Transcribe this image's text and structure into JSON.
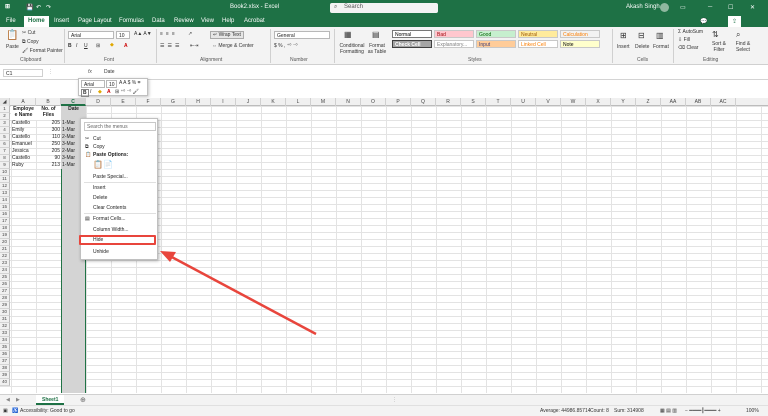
{
  "titlebar": {
    "filename": "Book2.xlsx - Excel",
    "search": "Search",
    "user": "Akash Singh"
  },
  "tabs": [
    "File",
    "Home",
    "Insert",
    "Page Layout",
    "Formulas",
    "Data",
    "Review",
    "View",
    "Help",
    "Acrobat"
  ],
  "ribbon": {
    "clipboard": {
      "paste": "Paste",
      "cut": "Cut",
      "copy": "Copy",
      "format_painter": "Format Painter",
      "label": "Clipboard"
    },
    "font": {
      "name": "Arial",
      "size": "10",
      "label": "Font"
    },
    "alignment": {
      "wrap": "Wrap Text",
      "merge": "Merge & Center",
      "label": "Alignment"
    },
    "number": {
      "format": "General",
      "label": "Number"
    },
    "styles": {
      "conditional": "Conditional Formatting",
      "format_table": "Format as Table",
      "items": [
        {
          "label": "Normal",
          "bg": "#ffffff",
          "fg": "#000000"
        },
        {
          "label": "Bad",
          "bg": "#ffc7ce",
          "fg": "#9c0006"
        },
        {
          "label": "Good",
          "bg": "#c6efce",
          "fg": "#006100"
        },
        {
          "label": "Neutral",
          "bg": "#ffeb9c",
          "fg": "#9c5700"
        },
        {
          "label": "Calculation",
          "bg": "#f2f2f2",
          "fg": "#fa7d00"
        },
        {
          "label": "Check Cell",
          "bg": "#a5a5a5",
          "fg": "#ffffff"
        },
        {
          "label": "Explanatory...",
          "bg": "#ffffff",
          "fg": "#7f7f7f"
        },
        {
          "label": "Input",
          "bg": "#ffcc99",
          "fg": "#3f3f76"
        },
        {
          "label": "Linked Cell",
          "bg": "#ffffff",
          "fg": "#fa7d00"
        },
        {
          "label": "Note",
          "bg": "#ffffcc",
          "fg": "#000000"
        }
      ],
      "label": "Styles"
    },
    "cells": {
      "insert": "Insert",
      "delete": "Delete",
      "format": "Format",
      "label": "Cells"
    },
    "editing": {
      "autosum": "AutoSum",
      "fill": "Fill",
      "clear": "Clear",
      "sort": "Sort & Filter",
      "find": "Find & Select",
      "label": "Editing"
    }
  },
  "formula_bar": {
    "namebox": "C1",
    "content": "Date"
  },
  "mini_toolbar": {
    "font": "Arial",
    "size": "10"
  },
  "columns": [
    "A",
    "B",
    "C",
    "D",
    "E",
    "F",
    "G",
    "H",
    "I",
    "J",
    "K",
    "L",
    "M",
    "N",
    "O",
    "P",
    "Q",
    "R",
    "S",
    "T",
    "U",
    "V",
    "W",
    "X",
    "Y",
    "Z",
    "AA",
    "AB",
    "AC"
  ],
  "rows": [
    "1",
    "2",
    "3",
    "4",
    "5",
    "6",
    "7",
    "8",
    "9",
    "10",
    "11",
    "12",
    "13",
    "14",
    "15",
    "16",
    "17",
    "18",
    "19",
    "20",
    "21",
    "22",
    "23",
    "24",
    "25",
    "26",
    "27",
    "28",
    "29",
    "30",
    "31",
    "32",
    "33",
    "34",
    "35",
    "36",
    "37",
    "38",
    "39",
    "40"
  ],
  "table": {
    "headers": [
      "Employe e Name",
      "No. of Files",
      "Date"
    ],
    "rows": [
      [
        "Castello",
        "205",
        "1-Mar"
      ],
      [
        "Emily",
        "300",
        "1-Mar"
      ],
      [
        "Castello",
        "110",
        "2-Mar"
      ],
      [
        "Emanuel",
        "250",
        "3-Mar"
      ],
      [
        "Jessica",
        "205",
        "2-Mar"
      ],
      [
        "Castello",
        "90",
        "3-Mar"
      ],
      [
        "Ruby",
        "213",
        "1-Mar"
      ]
    ]
  },
  "context_menu": {
    "search": "Search the menus",
    "cut": "Cut",
    "copy": "Copy",
    "paste_options": "Paste Options:",
    "paste_special": "Paste Special...",
    "insert": "Insert",
    "delete": "Delete",
    "clear": "Clear Contents",
    "format_cells": "Format Cells...",
    "column_width": "Column Width...",
    "hide": "Hide",
    "unhide": "Unhide"
  },
  "sheet_tab": "Sheet1",
  "status": {
    "accessibility": "Accessibility: Good to go",
    "average": "Average: 44986.85714",
    "count": "Count: 8",
    "sum": "Sum: 314908",
    "zoom": "100%"
  },
  "colors": {
    "excel_green": "#1e7145",
    "highlight": "#e8453c"
  }
}
